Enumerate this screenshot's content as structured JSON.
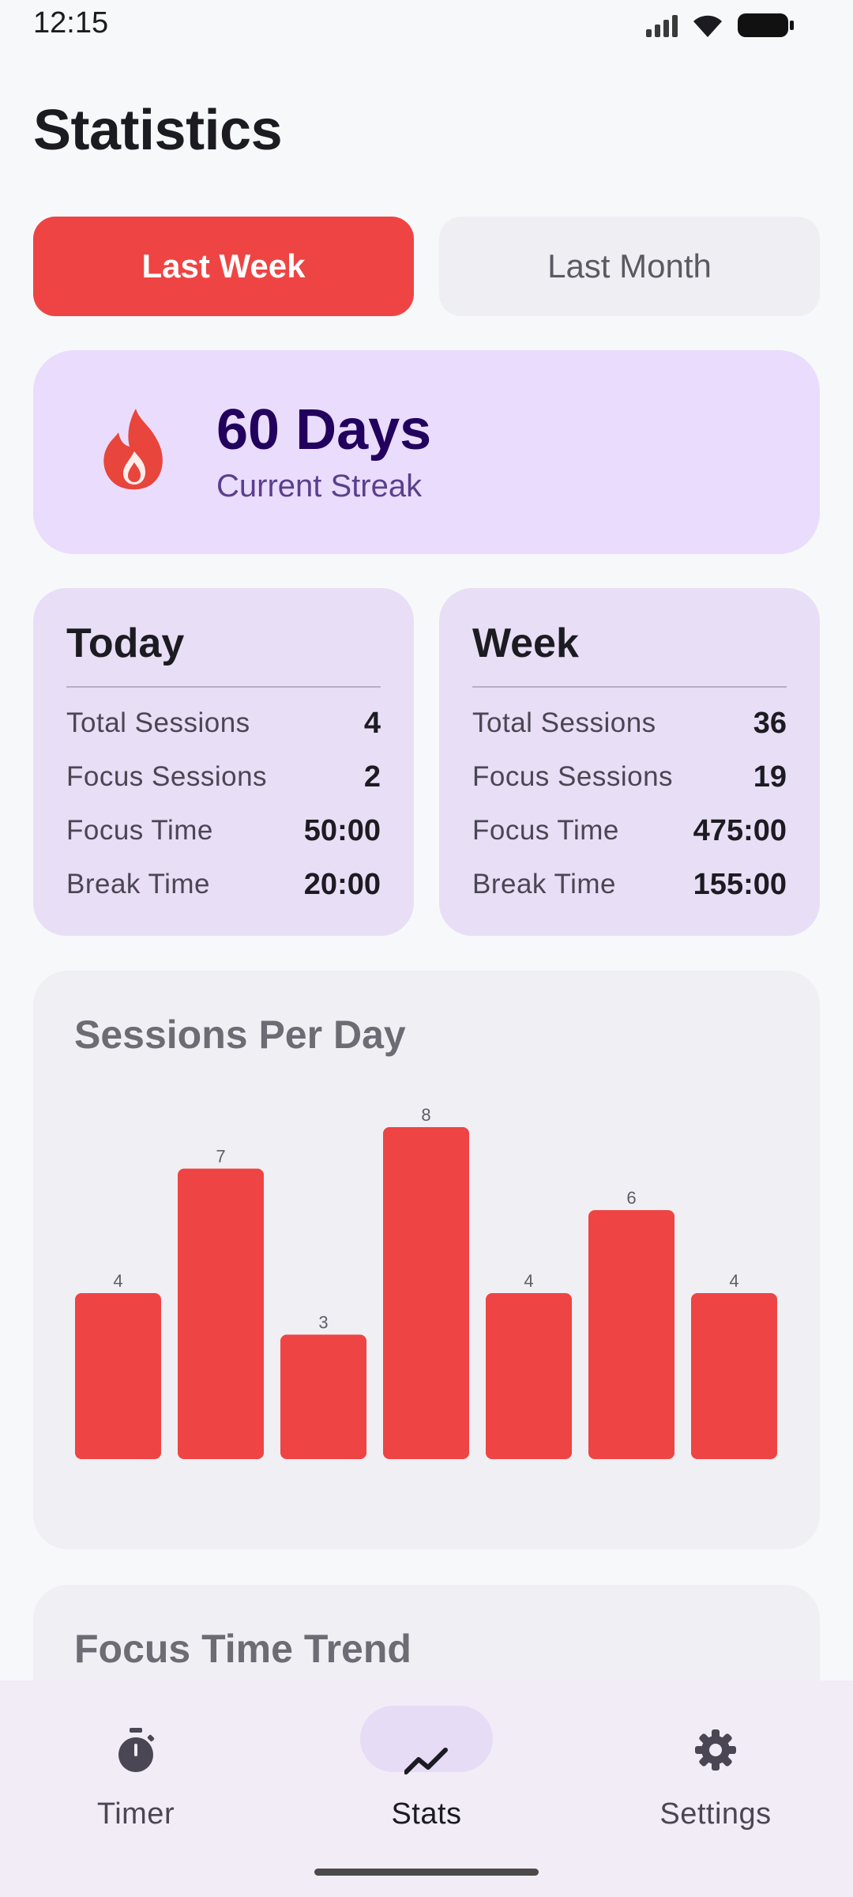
{
  "status_bar": {
    "time": "12:15"
  },
  "page": {
    "title": "Statistics"
  },
  "segments": {
    "week": "Last Week",
    "month": "Last Month",
    "selected": "week"
  },
  "streak": {
    "value": "60 Days",
    "label": "Current Streak",
    "icon": "flame-icon"
  },
  "today": {
    "title": "Today",
    "rows": [
      {
        "name": "Total Sessions",
        "value": "4"
      },
      {
        "name": "Focus Sessions",
        "value": "2"
      },
      {
        "name": "Focus Time",
        "value": "50:00"
      },
      {
        "name": "Break Time",
        "value": "20:00"
      }
    ]
  },
  "week": {
    "title": "Week",
    "rows": [
      {
        "name": "Total Sessions",
        "value": "36"
      },
      {
        "name": "Focus Sessions",
        "value": "19"
      },
      {
        "name": "Focus Time",
        "value": "475:00"
      },
      {
        "name": "Break Time",
        "value": "155:00"
      }
    ]
  },
  "chart_data": {
    "type": "bar",
    "title": "Sessions Per Day",
    "values": [
      4,
      7,
      3,
      8,
      4,
      6,
      4
    ],
    "data_labels": [
      "4",
      "7",
      "3",
      "8",
      "4",
      "6",
      "4"
    ],
    "ylim": [
      0,
      8
    ],
    "grid": false,
    "color": "#ef4444"
  },
  "trend": {
    "title": "Focus Time Trend"
  },
  "nav": {
    "timer": "Timer",
    "stats": "Stats",
    "settings": "Settings",
    "active": "stats"
  },
  "colors": {
    "accent": "#ef4444",
    "streak_bg": "#eadcfd",
    "card_bg": "#e8def5",
    "panel_bg": "#f0eff4"
  }
}
